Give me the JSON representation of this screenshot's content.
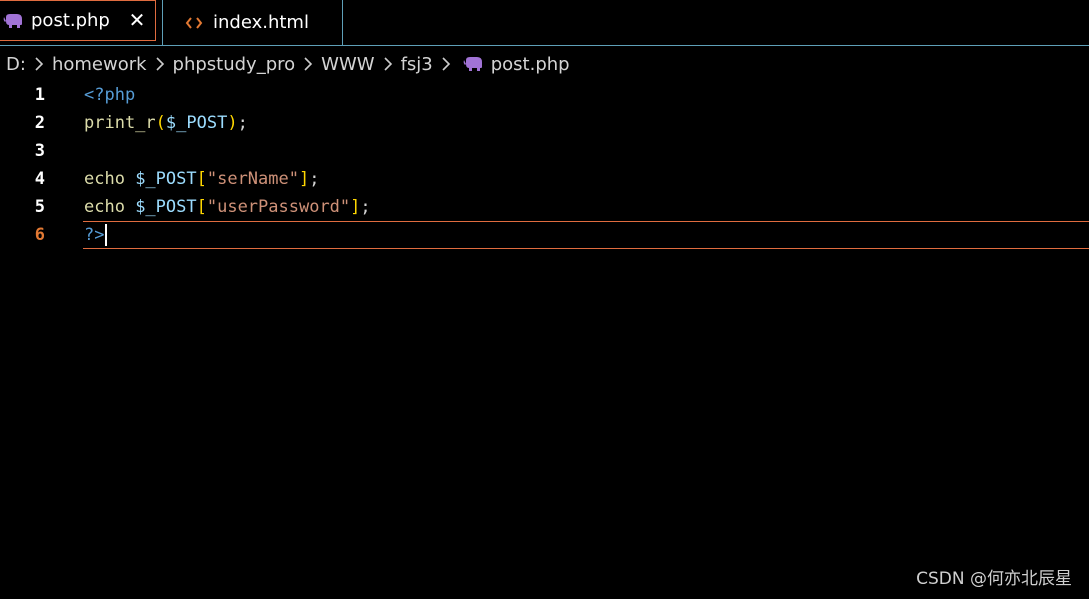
{
  "tabs": [
    {
      "label": "post.php",
      "icon": "php-elephant-icon",
      "active": true,
      "icon_color": "#a173d6"
    },
    {
      "label": "index.html",
      "icon": "html-code-icon",
      "active": false,
      "icon_color": "#e37933"
    }
  ],
  "close_symbol": "✕",
  "breadcrumb": {
    "items": [
      "D:",
      "homework",
      "phpstudy_pro",
      "WWW",
      "fsj3",
      "post.php"
    ]
  },
  "editor": {
    "current_line": 6,
    "lines": [
      {
        "number": "1",
        "tokens": [
          {
            "t": "<?php",
            "c": "kw"
          }
        ]
      },
      {
        "number": "2",
        "tokens": [
          {
            "t": "print_r",
            "c": "fn"
          },
          {
            "t": "(",
            "c": "br"
          },
          {
            "t": "$_POST",
            "c": "var"
          },
          {
            "t": ")",
            "c": "br"
          },
          {
            "t": ";",
            "c": "plain"
          }
        ]
      },
      {
        "number": "3",
        "tokens": []
      },
      {
        "number": "4",
        "tokens": [
          {
            "t": "echo ",
            "c": "fn"
          },
          {
            "t": "$_POST",
            "c": "var"
          },
          {
            "t": "[",
            "c": "br"
          },
          {
            "t": "\"serName\"",
            "c": "str"
          },
          {
            "t": "]",
            "c": "br"
          },
          {
            "t": ";",
            "c": "plain"
          }
        ]
      },
      {
        "number": "5",
        "tokens": [
          {
            "t": "echo ",
            "c": "fn"
          },
          {
            "t": "$_POST",
            "c": "var"
          },
          {
            "t": "[",
            "c": "br"
          },
          {
            "t": "\"userPassword\"",
            "c": "str"
          },
          {
            "t": "]",
            "c": "br"
          },
          {
            "t": ";",
            "c": "plain"
          }
        ]
      },
      {
        "number": "6",
        "tokens": [
          {
            "t": "?>",
            "c": "kw"
          }
        ]
      }
    ]
  },
  "watermark": "CSDN @何亦北辰星",
  "colors": {
    "background": "#000000",
    "accent_border": "#e06c3f",
    "tab_divider": "#5e9fb8"
  }
}
